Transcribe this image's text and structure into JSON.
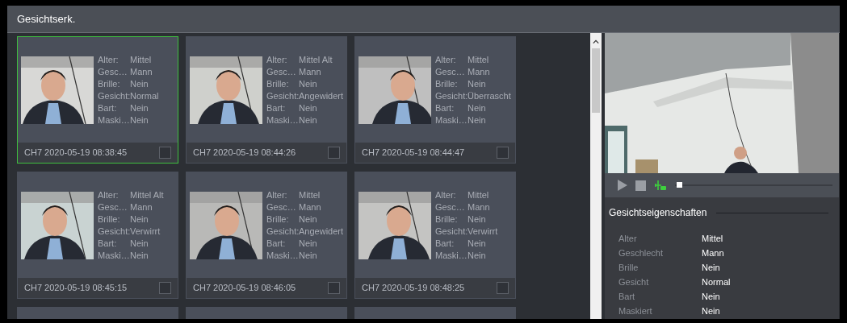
{
  "window": {
    "title": "Gesichtserk."
  },
  "cards": [
    {
      "selected": true,
      "checked": false,
      "timestamp": "CH7 2020-05-19 08:38:45",
      "attributes": [
        {
          "label": "Alter:",
          "value": "Mittel"
        },
        {
          "label": "Gesc…",
          "value": "Mann"
        },
        {
          "label": "Brille:",
          "value": "Nein"
        },
        {
          "label": "Gesicht:",
          "value": "Normal"
        },
        {
          "label": "Bart:",
          "value": "Nein"
        },
        {
          "label": "Maski…",
          "value": "Nein"
        }
      ]
    },
    {
      "selected": false,
      "checked": false,
      "timestamp": "CH7 2020-05-19 08:44:26",
      "attributes": [
        {
          "label": "Alter:",
          "value": "Mittel Alt"
        },
        {
          "label": "Gesc…",
          "value": "Mann"
        },
        {
          "label": "Brille:",
          "value": "Nein"
        },
        {
          "label": "Gesicht:",
          "value": "Angewidert"
        },
        {
          "label": "Bart:",
          "value": "Nein"
        },
        {
          "label": "Maski…",
          "value": "Nein"
        }
      ]
    },
    {
      "selected": false,
      "checked": false,
      "timestamp": "CH7 2020-05-19 08:44:47",
      "attributes": [
        {
          "label": "Alter:",
          "value": "Mittel"
        },
        {
          "label": "Gesc…",
          "value": "Mann"
        },
        {
          "label": "Brille:",
          "value": "Nein"
        },
        {
          "label": "Gesicht:",
          "value": "Überrascht"
        },
        {
          "label": "Bart:",
          "value": "Nein"
        },
        {
          "label": "Maski…",
          "value": "Nein"
        }
      ]
    },
    {
      "selected": false,
      "checked": false,
      "timestamp": "CH7 2020-05-19 08:45:15",
      "attributes": [
        {
          "label": "Alter:",
          "value": "Mittel Alt"
        },
        {
          "label": "Gesc…",
          "value": "Mann"
        },
        {
          "label": "Brille:",
          "value": "Nein"
        },
        {
          "label": "Gesicht:",
          "value": "Verwirrt"
        },
        {
          "label": "Bart:",
          "value": "Nein"
        },
        {
          "label": "Maski…",
          "value": "Nein"
        }
      ]
    },
    {
      "selected": false,
      "checked": false,
      "timestamp": "CH7 2020-05-19 08:46:05",
      "attributes": [
        {
          "label": "Alter:",
          "value": "Mittel"
        },
        {
          "label": "Gesc…",
          "value": "Mann"
        },
        {
          "label": "Brille:",
          "value": "Nein"
        },
        {
          "label": "Gesicht:",
          "value": "Angewidert"
        },
        {
          "label": "Bart:",
          "value": "Nein"
        },
        {
          "label": "Maski…",
          "value": "Nein"
        }
      ]
    },
    {
      "selected": false,
      "checked": false,
      "timestamp": "CH7 2020-05-19 08:48:25",
      "attributes": [
        {
          "label": "Alter:",
          "value": "Mittel"
        },
        {
          "label": "Gesc…",
          "value": "Mann"
        },
        {
          "label": "Brille:",
          "value": "Nein"
        },
        {
          "label": "Gesicht:",
          "value": "Verwirrt"
        },
        {
          "label": "Bart:",
          "value": "Nein"
        },
        {
          "label": "Maski…",
          "value": "Nein"
        }
      ]
    },
    {
      "kind": "partial"
    },
    {
      "kind": "partial"
    },
    {
      "kind": "partial"
    }
  ],
  "player": {
    "progress": {
      "level": 0.01
    }
  },
  "properties": {
    "title": "Gesichtseigenschaften",
    "rows": [
      {
        "label": "Alter",
        "value": "Mittel"
      },
      {
        "label": "Geschlecht",
        "value": "Mann"
      },
      {
        "label": "Brille",
        "value": "Nein"
      },
      {
        "label": "Gesicht",
        "value": "Normal"
      },
      {
        "label": "Bart",
        "value": "Nein"
      },
      {
        "label": "Maskiert",
        "value": "Nein"
      }
    ]
  }
}
